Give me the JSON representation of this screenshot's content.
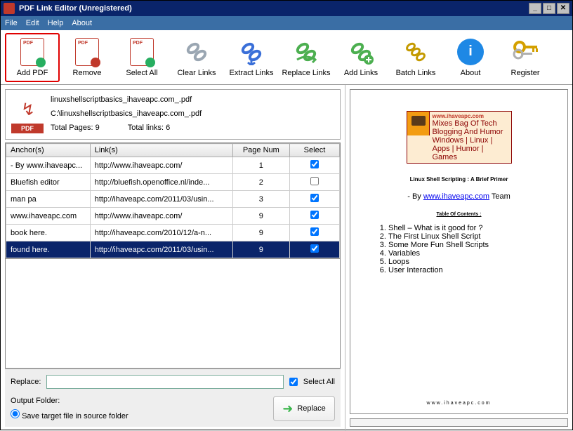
{
  "title": "PDF Link Editor (Unregistered)",
  "window_buttons": {
    "min": "_",
    "max": "□",
    "close": "✕"
  },
  "menu": [
    "File",
    "Edit",
    "Help",
    "About"
  ],
  "toolbar": [
    {
      "id": "add-pdf",
      "label": "Add PDF",
      "highlight": true
    },
    {
      "id": "remove",
      "label": "Remove"
    },
    {
      "id": "select-all",
      "label": "Select All"
    },
    {
      "id": "clear-links",
      "label": "Clear Links"
    },
    {
      "id": "extract-links",
      "label": "Extract Links"
    },
    {
      "id": "replace-links",
      "label": "Replace Links"
    },
    {
      "id": "add-links",
      "label": "Add Links"
    },
    {
      "id": "batch-links",
      "label": "Batch Links"
    },
    {
      "id": "about",
      "label": "About"
    },
    {
      "id": "register",
      "label": "Register"
    }
  ],
  "file": {
    "name": "linuxshellscriptbasics_ihaveapc.com_.pdf",
    "path": "C:\\linuxshellscriptbasics_ihaveapc.com_.pdf",
    "pages_label": "Total Pages: 9",
    "links_label": "Total links: 6",
    "badge": "PDF"
  },
  "grid": {
    "headers": [
      "Anchor(s)",
      "Link(s)",
      "Page Num",
      "Select"
    ],
    "rows": [
      {
        "anchor": "- By www.ihaveapc...",
        "link": "http://www.ihaveapc.com/",
        "page": "1",
        "checked": true,
        "selected": false
      },
      {
        "anchor": "Bluefish   editor",
        "link": "http://bluefish.openoffice.nl/inde...",
        "page": "2",
        "checked": false,
        "selected": false
      },
      {
        "anchor": "man pa",
        "link": "http://ihaveapc.com/2011/03/usin...",
        "page": "3",
        "checked": true,
        "selected": false
      },
      {
        "anchor": "www.ihaveapc.com",
        "link": "http://www.ihaveapc.com/",
        "page": "9",
        "checked": true,
        "selected": false
      },
      {
        "anchor": "book here.",
        "link": "http://ihaveapc.com/2010/12/a-n...",
        "page": "9",
        "checked": true,
        "selected": false
      },
      {
        "anchor": "found here.",
        "link": "http://ihaveapc.com/2011/03/usin...",
        "page": "9",
        "checked": true,
        "selected": true
      }
    ]
  },
  "bottom": {
    "replace_label": "Replace:",
    "replace_value": "",
    "selectall_label": "Select All",
    "selectall_checked": true,
    "output_label": "Output Folder:",
    "save_option": "Save target file in source folder",
    "replace_btn": "Replace"
  },
  "preview": {
    "site": "www.ihaveapc.com",
    "tagline1": "Mixes Bag Of Tech Blogging And Humor",
    "tagline2": "Windows | Linux | Apps | Humor | Games",
    "title": "Linux Shell Scripting : A Brief Primer",
    "by_prefix": "- By ",
    "by_link": "www.ihaveapc.com",
    "by_suffix": " Team",
    "toc_title": "Table Of Contents :",
    "toc": [
      "Shell – What is it good for ?",
      "The First Linux Shell Script",
      "Some More Fun Shell Scripts",
      "Variables",
      "Loops",
      "User Interaction"
    ],
    "footer": "www.ihaveapc.com"
  }
}
